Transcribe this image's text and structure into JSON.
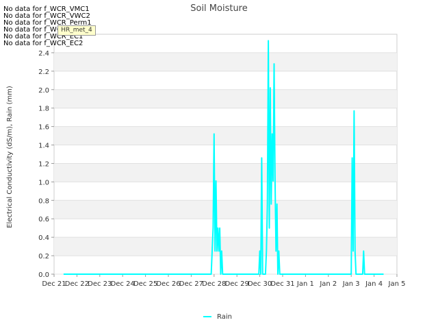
{
  "chart_data": {
    "type": "line",
    "title": "Soil Moisture",
    "ylabel": "Electrical Conductivity (dS/m), Rain (mm)",
    "xlabel": "",
    "ylim": [
      0,
      2.6
    ],
    "yticks": [
      0.0,
      0.2,
      0.4,
      0.6,
      0.8,
      1.0,
      1.2,
      1.4,
      1.6,
      1.8,
      2.0,
      2.2,
      2.4
    ],
    "ytick_labels": [
      "0.0",
      "0.2",
      "0.4",
      "0.6",
      "0.8",
      "1.0",
      "1.2",
      "1.4",
      "1.6",
      "1.8",
      "2.0",
      "2.2",
      "2.4"
    ],
    "xlim": [
      "2019-12-21T00:00",
      "2020-01-05T00:00"
    ],
    "xticks": [
      "2019-12-21",
      "2019-12-22",
      "2019-12-23",
      "2019-12-24",
      "2019-12-25",
      "2019-12-26",
      "2019-12-27",
      "2019-12-28",
      "2019-12-29",
      "2019-12-30",
      "2019-12-31",
      "2020-01-01",
      "2020-01-02",
      "2020-01-03",
      "2020-01-04",
      "2020-01-05"
    ],
    "xtick_labels": [
      "Dec 21",
      "Dec 22",
      "Dec 23",
      "Dec 24",
      "Dec 25",
      "Dec 26",
      "Dec 27",
      "Dec 28",
      "Dec 29",
      "Dec 30",
      "Dec 31",
      "Jan 1",
      "Jan 2",
      "Jan 3",
      "Jan 4",
      "Jan 5"
    ],
    "grid": "horizontal bands",
    "legend_position": "bottom-center",
    "series": [
      {
        "name": "Rain",
        "color": "#00ffff",
        "points": [
          [
            "2019-12-21T10:00",
            0
          ],
          [
            "2019-12-27T21:00",
            0
          ],
          [
            "2019-12-27T23:00",
            0.5
          ],
          [
            "2019-12-28T00:00",
            1.52
          ],
          [
            "2019-12-28T01:00",
            0.25
          ],
          [
            "2019-12-28T02:00",
            1.01
          ],
          [
            "2019-12-28T03:00",
            0.25
          ],
          [
            "2019-12-28T04:00",
            0.5
          ],
          [
            "2019-12-28T05:00",
            0.25
          ],
          [
            "2019-12-28T06:00",
            0.5
          ],
          [
            "2019-12-28T07:00",
            0
          ],
          [
            "2019-12-28T08:00",
            0.25
          ],
          [
            "2019-12-28T09:00",
            0
          ],
          [
            "2019-12-29T23:00",
            0
          ],
          [
            "2019-12-30T00:00",
            0.25
          ],
          [
            "2019-12-30T01:00",
            0
          ],
          [
            "2019-12-30T02:00",
            1.26
          ],
          [
            "2019-12-30T03:00",
            0
          ],
          [
            "2019-12-30T06:00",
            0
          ],
          [
            "2019-12-30T07:00",
            0.25
          ],
          [
            "2019-12-30T08:00",
            0.76
          ],
          [
            "2019-12-30T09:00",
            2.53
          ],
          [
            "2019-12-30T10:00",
            0.5
          ],
          [
            "2019-12-30T11:00",
            2.02
          ],
          [
            "2019-12-30T12:00",
            0.76
          ],
          [
            "2019-12-30T13:00",
            1.52
          ],
          [
            "2019-12-30T14:00",
            1.01
          ],
          [
            "2019-12-30T15:00",
            2.28
          ],
          [
            "2019-12-30T16:00",
            1.01
          ],
          [
            "2019-12-30T17:00",
            0.25
          ],
          [
            "2019-12-30T18:00",
            0.76
          ],
          [
            "2019-12-30T19:00",
            0
          ],
          [
            "2019-12-30T20:00",
            0.25
          ],
          [
            "2019-12-30T21:00",
            0
          ],
          [
            "2020-01-03T00:00",
            0
          ],
          [
            "2020-01-03T01:00",
            1.26
          ],
          [
            "2020-01-03T02:00",
            0.25
          ],
          [
            "2020-01-03T03:00",
            1.77
          ],
          [
            "2020-01-03T04:00",
            0.25
          ],
          [
            "2020-01-03T05:00",
            0
          ],
          [
            "2020-01-03T12:00",
            0
          ],
          [
            "2020-01-03T13:00",
            0.25
          ],
          [
            "2020-01-03T14:00",
            0
          ],
          [
            "2020-01-04T10:00",
            0
          ]
        ]
      }
    ]
  },
  "no_data_messages": [
    "No data for f_WCR_VMC1",
    "No data for f_WCR_VWC2",
    "No data for f_WCR_Perm1",
    "No data for f_WCR_Perm2",
    "No data for f_WCR_EC1",
    "No data for f_WCR_EC2"
  ],
  "tooltip_label": "HR_met_4",
  "colors": {
    "band": "#f2f2f2",
    "gridline": "#e0e0e0",
    "axis": "#cccccc",
    "tick_text": "#333333",
    "title_text": "#444444"
  }
}
